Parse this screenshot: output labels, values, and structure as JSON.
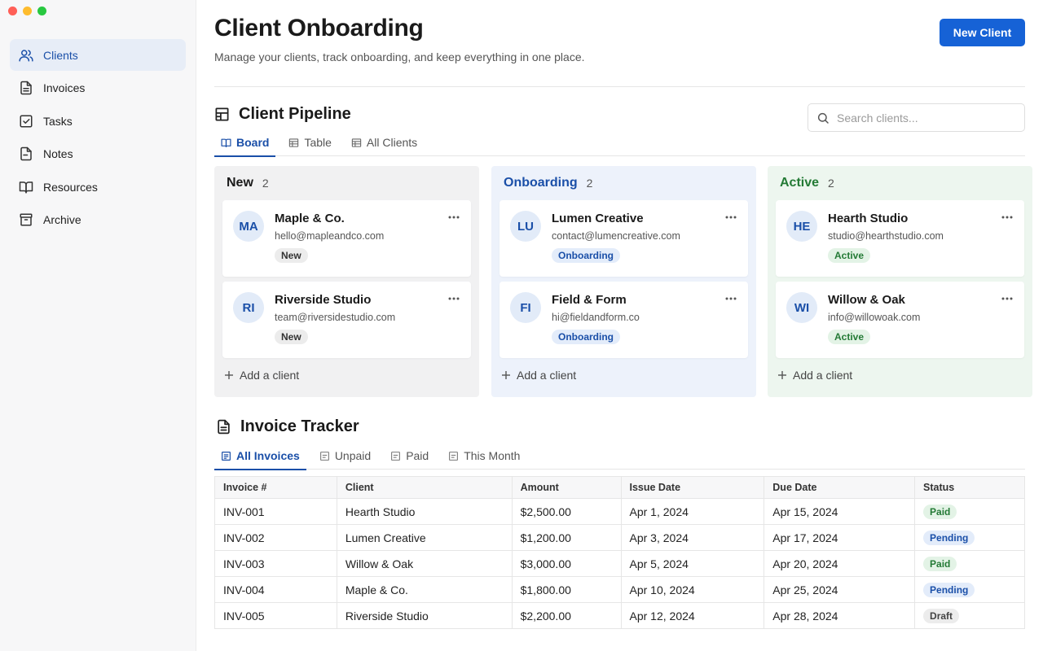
{
  "window": {
    "traffic_colors": [
      "#ff5f57",
      "#febc2e",
      "#28c840"
    ]
  },
  "sidebar": {
    "items": [
      {
        "label": "Clients",
        "icon": "users-icon",
        "active": true
      },
      {
        "label": "Invoices",
        "icon": "file-text-icon",
        "active": false
      },
      {
        "label": "Tasks",
        "icon": "check-square-icon",
        "active": false
      },
      {
        "label": "Notes",
        "icon": "file-icon",
        "active": false
      },
      {
        "label": "Resources",
        "icon": "book-icon",
        "active": false
      },
      {
        "label": "Archive",
        "icon": "archive-icon",
        "active": false
      }
    ]
  },
  "header": {
    "title": "Client Onboarding",
    "subtitle": "Manage your clients, track onboarding, and keep everything in one place.",
    "new_client_label": "New Client"
  },
  "pipeline": {
    "title": "Client Pipeline",
    "search_placeholder": "Search clients...",
    "tabs": [
      {
        "label": "Board",
        "active": true
      },
      {
        "label": "Table",
        "active": false
      },
      {
        "label": "All Clients",
        "active": false
      }
    ],
    "add_label": "Add a client",
    "columns": [
      {
        "title": "New",
        "count": "2",
        "cards": [
          {
            "initials": "MA",
            "name": "Maple & Co.",
            "email": "hello@mapleandco.com",
            "status": "New"
          },
          {
            "initials": "RI",
            "name": "Riverside Studio",
            "email": "team@riversidestudio.com",
            "status": "New"
          }
        ]
      },
      {
        "title": "Onboarding",
        "count": "2",
        "cards": [
          {
            "initials": "LU",
            "name": "Lumen Creative",
            "email": "contact@lumencreative.com",
            "status": "Onboarding"
          },
          {
            "initials": "FI",
            "name": "Field & Form",
            "email": "hi@fieldandform.co",
            "status": "Onboarding"
          }
        ]
      },
      {
        "title": "Active",
        "count": "2",
        "cards": [
          {
            "initials": "HE",
            "name": "Hearth Studio",
            "email": "studio@hearthstudio.com",
            "status": "Active"
          },
          {
            "initials": "WI",
            "name": "Willow & Oak",
            "email": "info@willowoak.com",
            "status": "Active"
          }
        ]
      }
    ]
  },
  "invoices": {
    "title": "Invoice Tracker",
    "tabs": [
      {
        "label": "All Invoices",
        "active": true
      },
      {
        "label": "Unpaid",
        "active": false
      },
      {
        "label": "Paid",
        "active": false
      },
      {
        "label": "This Month",
        "active": false
      }
    ],
    "columns": [
      "Invoice #",
      "Client",
      "Amount",
      "Issue Date",
      "Due Date",
      "Status"
    ],
    "rows": [
      [
        "INV-001",
        "Hearth Studio",
        "$2,500.00",
        "Apr 1, 2024",
        "Apr 15, 2024",
        "Paid"
      ],
      [
        "INV-002",
        "Lumen Creative",
        "$1,200.00",
        "Apr 3, 2024",
        "Apr 17, 2024",
        "Pending"
      ],
      [
        "INV-003",
        "Willow & Oak",
        "$3,000.00",
        "Apr 5, 2024",
        "Apr 20, 2024",
        "Paid"
      ],
      [
        "INV-004",
        "Maple & Co.",
        "$1,800.00",
        "Apr 10, 2024",
        "Apr 25, 2024",
        "Pending"
      ],
      [
        "INV-005",
        "Riverside Studio",
        "$2,200.00",
        "Apr 12, 2024",
        "Apr 28, 2024",
        "Draft"
      ]
    ]
  },
  "colors": {
    "accent": "#1662d6",
    "accent_text": "#1a4fa8",
    "col_new_bg": "#f1f1f2",
    "col_onboarding_bg": "#edf2fb",
    "col_active_bg": "#edf6ef",
    "col_active_title": "#237a35"
  }
}
